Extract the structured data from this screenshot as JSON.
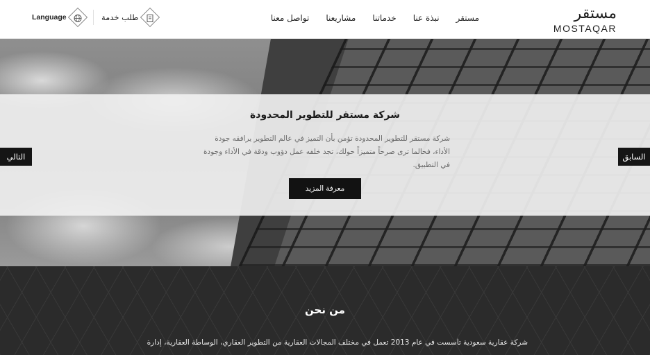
{
  "header": {
    "logo_ar": "مستقر",
    "logo_en": "MOSTAQAR",
    "nav": [
      "مستقر",
      "نبذة عنا",
      "خدماتنا",
      "مشاريعنا",
      "تواصل معنا"
    ],
    "service_label": "طلب خدمة",
    "language_label": "Language"
  },
  "hero": {
    "title": "شركة مستقر للتطوير المحدودة",
    "text": "شركة مستقر للتطوير المحدودة تؤمن بأن التميز في عالم التطوير يرافقه جودة الأداء، فحالما ترى صرحاً متميزاً حولك، تجد خلفه عمل دؤوب ودقة في الأداء وجودة في التطبيق.",
    "more_button": "معرفة المزيد",
    "prev_button": "السابق",
    "next_button": "التالي"
  },
  "about": {
    "title": "من نحن",
    "text": "شركة عقارية سعودية تأسست في عام 2013 تعمل في مختلف المجالات العقارية من التطوير العقاري، الوساطة العقارية، إدارة"
  },
  "icons": {
    "logo": "diamond-logo-icon",
    "service": "document-icon",
    "language": "globe-icon"
  },
  "colors": {
    "dark": "#121212",
    "about_bg": "#2b2b2b",
    "overlay": "#f0f0f0"
  }
}
